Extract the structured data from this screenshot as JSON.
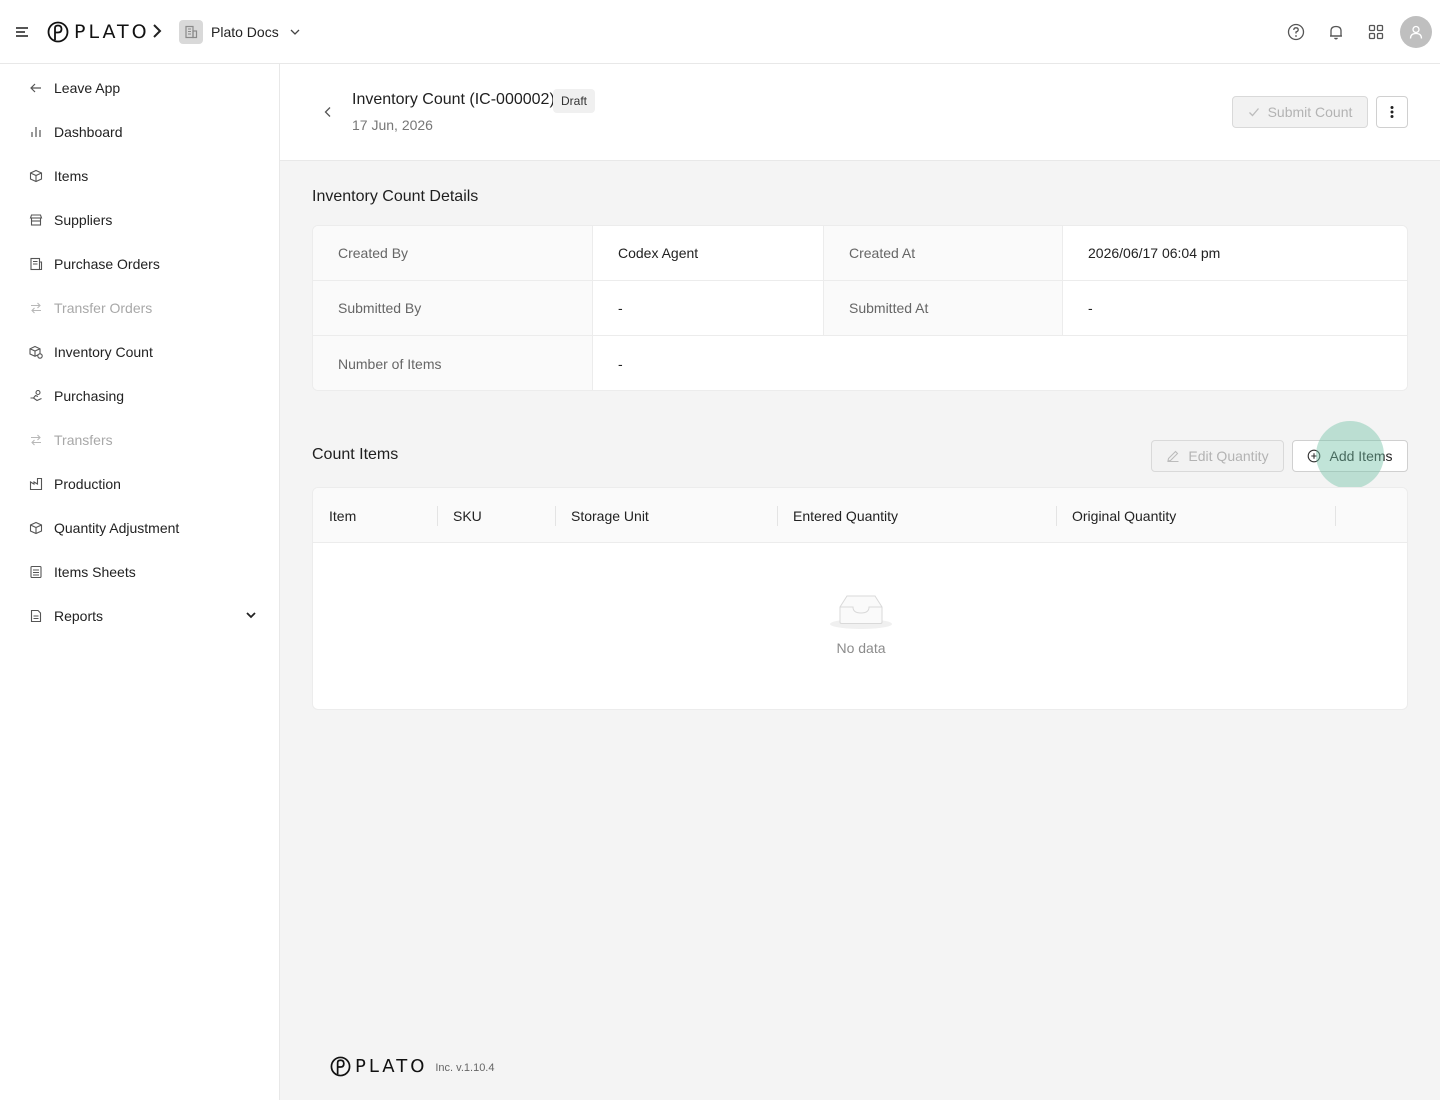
{
  "header": {
    "logo_text": "PLATO",
    "org_name": "Plato Docs"
  },
  "sidebar": {
    "items": [
      {
        "label": "Leave App",
        "icon": "arrow-left-icon",
        "disabled": false
      },
      {
        "label": "Dashboard",
        "icon": "bar-chart-icon",
        "disabled": false
      },
      {
        "label": "Items",
        "icon": "box-icon",
        "disabled": false
      },
      {
        "label": "Suppliers",
        "icon": "store-icon",
        "disabled": false
      },
      {
        "label": "Purchase Orders",
        "icon": "purchase-order-icon",
        "disabled": false
      },
      {
        "label": "Transfer Orders",
        "icon": "transfer-icon",
        "disabled": true
      },
      {
        "label": "Inventory Count",
        "icon": "inventory-count-icon",
        "disabled": false
      },
      {
        "label": "Purchasing",
        "icon": "purchasing-icon",
        "disabled": false
      },
      {
        "label": "Transfers",
        "icon": "transfer-icon",
        "disabled": true
      },
      {
        "label": "Production",
        "icon": "factory-icon",
        "disabled": false
      },
      {
        "label": "Quantity Adjustment",
        "icon": "adjust-box-icon",
        "disabled": false
      },
      {
        "label": "Items Sheets",
        "icon": "sheet-icon",
        "disabled": false
      },
      {
        "label": "Reports",
        "icon": "report-icon",
        "disabled": false
      }
    ]
  },
  "page": {
    "title": "Inventory Count (IC-000002)",
    "status": "Draft",
    "date": "17 Jun, 2026",
    "submit_label": "Submit Count"
  },
  "details": {
    "title": "Inventory Count Details",
    "created_by_label": "Created By",
    "created_by": "Codex Agent",
    "created_at_label": "Created At",
    "created_at": "2026/06/17 06:04 pm",
    "submitted_by_label": "Submitted By",
    "submitted_by": "-",
    "submitted_at_label": "Submitted At",
    "submitted_at": "-",
    "num_items_label": "Number of Items",
    "num_items": "-"
  },
  "count_items": {
    "title": "Count Items",
    "edit_label": "Edit Quantity",
    "add_label": "Add Items",
    "columns": [
      "Item",
      "SKU",
      "Storage Unit",
      "Entered Quantity",
      "Original Quantity"
    ],
    "empty_text": "No data"
  },
  "footer": {
    "logo_text": "PLATO",
    "version": "Inc. v.1.10.4"
  },
  "colors": {
    "accent_ripple": "#75c4a8",
    "disabled_text": "#b3b3b3",
    "page_bg": "#f4f4f4"
  }
}
